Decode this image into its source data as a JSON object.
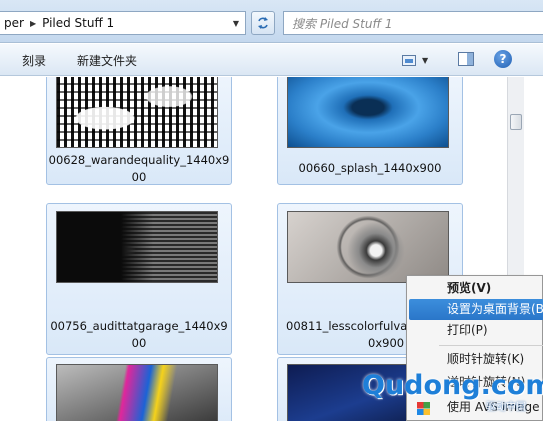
{
  "address": {
    "path": [
      "per",
      "Piled Stuff 1"
    ]
  },
  "search": {
    "placeholder": "搜索 Piled Stuff 1"
  },
  "toolbar": {
    "burn_label": "刻录",
    "new_folder_label": "新建文件夹"
  },
  "files": [
    {
      "caption_line1": "00628_warandequality_1440x9",
      "caption_line2": "00"
    },
    {
      "caption_line1": "00660_splash_1440x900",
      "caption_line2": ""
    },
    {
      "caption_line1": "00756_audittatgarage_1440x9",
      "caption_line2": "00"
    },
    {
      "caption_line1": "00811_lesscolorfulva",
      "caption_line2": "0x900"
    }
  ],
  "context_menu": {
    "items": [
      {
        "label": "预览(V)"
      },
      {
        "label": "设置为桌面背景(B)"
      },
      {
        "label": "打印(P)"
      },
      {
        "label": "顺时针旋转(K)"
      },
      {
        "label": "逆时针旋转(N)"
      },
      {
        "label": "使用 AVS Image 进"
      }
    ]
  },
  "watermark": {
    "brand": "Qudong.com",
    "subtitle": "驱动中国"
  },
  "icons": {
    "breadcrumb_separator": "triangle-right",
    "refresh": "refresh-arrows",
    "views": "views-picture",
    "preview_pane": "preview-pane",
    "help": "question-mark"
  }
}
